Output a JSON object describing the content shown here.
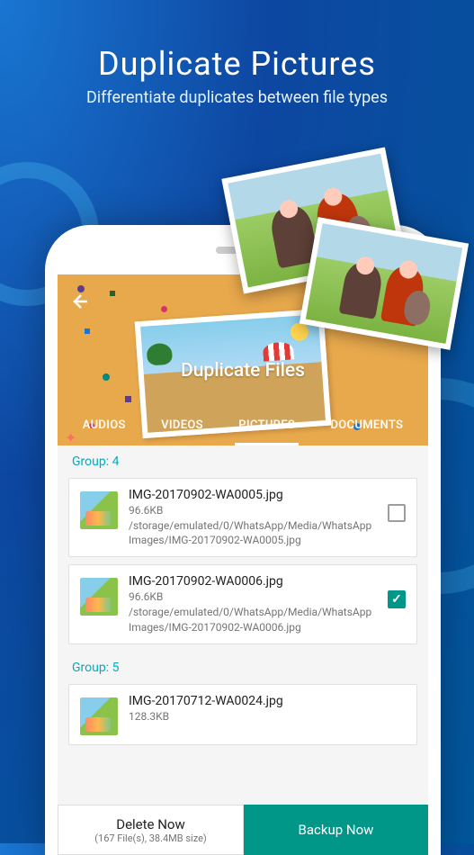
{
  "promo": {
    "title": "Duplicate Pictures",
    "subtitle": "Differentiate duplicates between file types"
  },
  "app": {
    "header_title": "Duplicate Files",
    "tabs": {
      "audios": "AUDIOS",
      "videos": "VIDEOS",
      "pictures": "PICTURES",
      "documents": "DOCUMENTS"
    },
    "groups": {
      "g4": "Group: 4",
      "g5": "Group: 5"
    },
    "files": {
      "0": {
        "name": "IMG-20170902-WA0005.jpg",
        "size": "96.6KB",
        "path": "/storage/emulated/0/WhatsApp/Media/WhatsApp Images/IMG-20170902-WA0005.jpg"
      },
      "1": {
        "name": "IMG-20170902-WA0006.jpg",
        "size": "96.6KB",
        "path": "/storage/emulated/0/WhatsApp/Media/WhatsApp Images/IMG-20170902-WA0006.jpg"
      },
      "2": {
        "name": "IMG-20170712-WA0024.jpg",
        "size": "128.3KB"
      }
    },
    "delete": {
      "label": "Delete Now",
      "sub": "(167 File(s), 38.4MB size)"
    },
    "backup_label": "Backup Now"
  }
}
